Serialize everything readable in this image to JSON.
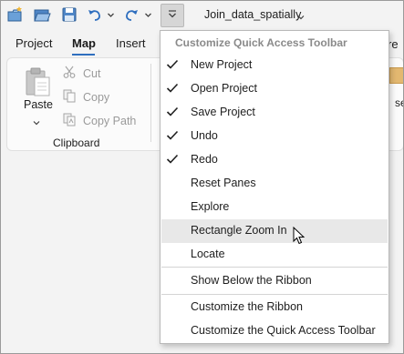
{
  "window": {
    "project_name": "Join_data_spatially"
  },
  "quick_access_toolbar": {
    "buttons": [
      {
        "icon": "new-project-icon"
      },
      {
        "icon": "open-project-icon"
      },
      {
        "icon": "save-project-icon"
      },
      {
        "icon": "undo-icon"
      },
      {
        "icon": "redo-icon"
      },
      {
        "icon": "customize-dropdown-icon"
      }
    ]
  },
  "ribbon": {
    "tabs": [
      {
        "label": "Project"
      },
      {
        "label": "Map",
        "active": true
      },
      {
        "label": "Insert"
      }
    ],
    "edge_tab_fragment": "re",
    "edge_item_fragment": "se",
    "clipboard": {
      "paste_label": "Paste",
      "cut_label": "Cut",
      "copy_label": "Copy",
      "copy_path_label": "Copy Path",
      "group_label": "Clipboard"
    }
  },
  "menu": {
    "header": "Customize Quick Access Toolbar",
    "items": [
      {
        "label": "New Project",
        "checked": true
      },
      {
        "label": "Open Project",
        "checked": true
      },
      {
        "label": "Save Project",
        "checked": true
      },
      {
        "label": "Undo",
        "checked": true
      },
      {
        "label": "Redo",
        "checked": true
      },
      {
        "label": "Reset Panes",
        "checked": false
      },
      {
        "label": "Explore",
        "checked": false
      },
      {
        "label": "Rectangle Zoom In",
        "checked": false,
        "hovered": true
      },
      {
        "label": "Locate",
        "checked": false
      },
      {
        "label": "Show Below the Ribbon",
        "checked": false
      },
      {
        "label": "Customize the Ribbon",
        "checked": false
      },
      {
        "label": "Customize the Quick Access Toolbar",
        "checked": false
      }
    ]
  },
  "colors": {
    "accent": "#2f6fbf",
    "hover": "#e8e8e8"
  }
}
